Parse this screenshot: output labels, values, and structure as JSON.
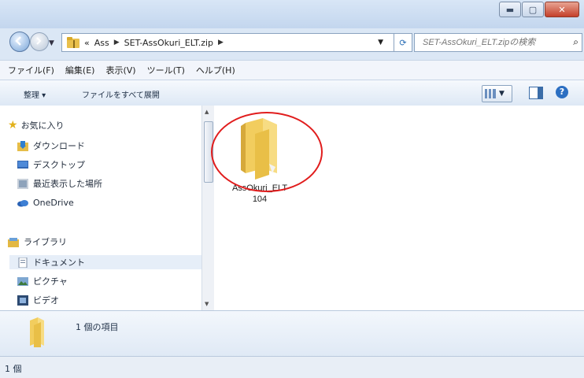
{
  "window": {
    "caption_buttons": [
      "minimize",
      "maximize",
      "close"
    ]
  },
  "address_bar": {
    "crumbs": [
      "«",
      "Ass",
      "SET-AssOkuri_ELT.zip"
    ],
    "search_placeholder": "SET-AssOkuri_ELT.zipの検索"
  },
  "menu": {
    "items": [
      "ファイル(F)",
      "編集(E)",
      "表示(V)",
      "ツール(T)",
      "ヘルプ(H)"
    ]
  },
  "commands": {
    "organize": "整理 ▾",
    "expand_all": "ファイルをすべて展開"
  },
  "nav_pane": {
    "favorites": "お気に入り",
    "downloads": "ダウンロード",
    "desktop": "デスクトップ",
    "recent": "最近表示した場所",
    "onedrive": "OneDrive",
    "libraries": "ライブラリ",
    "documents": "ドキュメント",
    "pictures": "ピクチャ",
    "videos": "ビデオ"
  },
  "files": [
    {
      "name": "AssOkuri_ELT104"
    }
  ],
  "details_pane": {
    "item_count": "1 個の項目"
  },
  "status_bar": {
    "text": "1 個"
  },
  "colors": {
    "highlight_circle": "#e11d1d",
    "folder_yellow": "#f2cd5e",
    "close_button": "#c4402a"
  }
}
